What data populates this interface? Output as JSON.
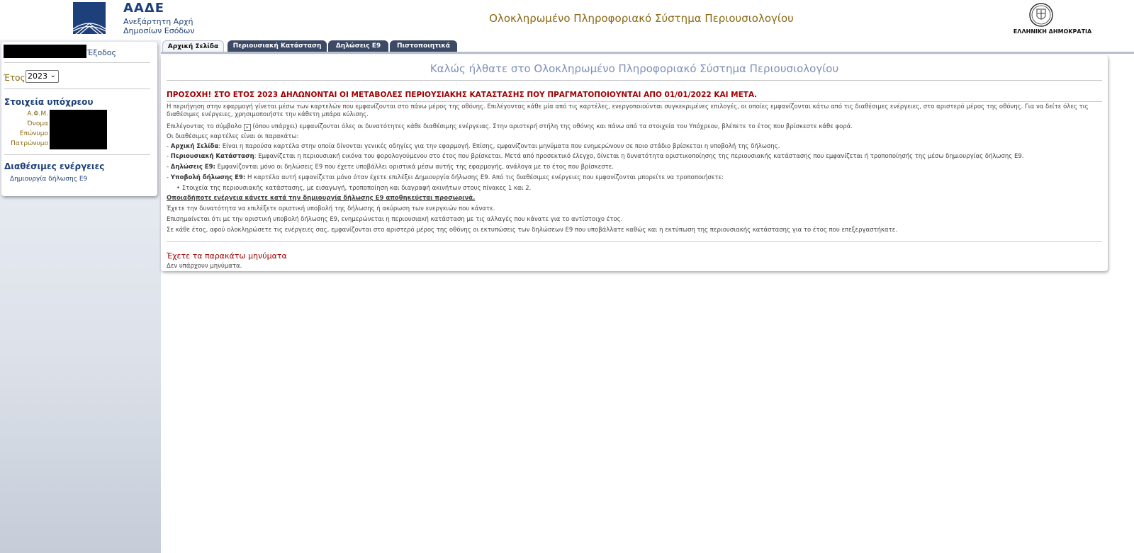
{
  "header": {
    "org_short": "ΑΑΔΕ",
    "org_line1": "Ανεξάρτητη Αρχή",
    "org_line2": "Δημοσίων Εσόδων",
    "app_title": "Ολοκληρωμένο Πληροφοριακό Σύστημα Περιουσιολογίου",
    "republic": "ΕΛΛΗΝΙΚΗ ΔΗΜΟΚΡΑΤΙΑ"
  },
  "sidebar": {
    "exit_label": "Έξοδος",
    "year_label": "Έτος",
    "year_value": "2023",
    "taxpayer_title": "Στοιχεία υπόχρεου",
    "fields": [
      "Α.Φ.Μ.",
      "Όνομα",
      "Επώνυμο",
      "Πατρώνυμο"
    ],
    "actions_title": "Διαθέσιμες ενέργειες",
    "action_create": "Δημιουργία δήλωσης Ε9"
  },
  "tabs": [
    "Αρχική Σελίδα",
    "Περιουσιακή Κατάσταση",
    "Δηλώσεις Ε9",
    "Πιστοποιητικά"
  ],
  "main": {
    "welcome": "Καλώς ήλθατε στο Ολοκληρωμένο Πληροφοριακό Σύστημα Περιουσιολογίου",
    "warning": "ΠΡΟΣΟΧΗ! ΣΤΟ ΕΤΟΣ 2023 ΔΗΛΩΝΟΝΤΑΙ ΟΙ ΜΕΤΑΒΟΛΕΣ ΠΕΡΙΟΥΣΙΑΚΗΣ ΚΑΤΑΣΤΑΣΗΣ ΠΟΥ ΠΡΑΓΜΑΤΟΠΟΙΟΥΝΤΑΙ ΑΠΟ 01/01/2022 ΚΑΙ ΜΕΤΑ.",
    "intro": "Η περιήγηση στην εφαρμογή γίνεται μέσω των καρτελών που εμφανίζονται στο πάνω μέρος της οθόνης. Επιλέγοντας κάθε μία από τις καρτέλες, ενεργοποιούνται συγκεκριμένες επιλογές, οι οποίες εμφανίζονται κάτω από τις διαθέσιμες ενέργειες, στο αριστερό μέρος της οθόνης. Για να δείτε όλες τις διαθέσιμες ενέργειες, χρησιμοποιήστε την κάθετη μπάρα κύλισης.",
    "symbol_a": "Επιλέγοντας το σύμβολο",
    "symbol_b": "(όπου υπάρχει) εμφανίζονται όλες οι δυνατότητες κάθε διαθέσιμης ενέργειας. Στην αριστερή στήλη της οθόνης και πάνω από τα στοιχεία του Υπόχρεου, βλέπετε το έτος που βρίσκεστε κάθε φορά.",
    "tabs_intro": "Οι διαθέσιμες καρτέλες είναι οι παρακάτω:",
    "tab_home_name": "Αρχική Σελίδα",
    "tab_home_desc": ": Είναι η παρούσα καρτέλα στην οποία δίνονται γενικές οδηγίες για την εφαρμογή. Επίσης, εμφανίζονται μηνύματα που ενημερώνουν σε ποιο στάδιο βρίσκεται η υποβολή της δήλωσης.",
    "tab_assets_name": "Περιουσιακή Κατάσταση",
    "tab_assets_desc": ": Εμφανίζεται η περιουσιακή εικόνα του φορολογούμενου στο έτος που βρίσκεται. Μετά από προσεκτικό έλεγχο, δίνεται η δυνατότητα οριστικοποίησης της περιουσιακής κατάστασης που εμφανίζεται ή τροποποίησής της μέσω δημιουργίας δήλωσης Ε9.",
    "tab_decl_name": "Δηλώσεις Ε9:",
    "tab_decl_desc": " Εμφανίζονται μόνο οι δηλώσεις Ε9 που έχετε υποβάλλει οριστικά μέσω αυτής της εφαρμογής, ανάλογα με το έτος που βρίσκεστε.",
    "tab_submit_name": "Υποβολή δήλωσης Ε9:",
    "tab_submit_desc": " Η καρτέλα αυτή εμφανίζεται μόνο όταν έχετε επιλέξει Δημιουργία δήλωσης Ε9. Από τις διαθέσιμες ενέργειες που εμφανίζονται μπορείτε να τροποποιήσετε:",
    "bullet": "Στοιχεία της περιουσιακής κατάστασης, με εισαγωγή, τροποποίηση και διαγραφή ακινήτων στους πίνακες 1 και 2.",
    "temp_note": "Οποιαδήποτε ενέργεια κάνετε κατά την δημιουργία δήλωσης Ε9 αποθηκεύεται προσωρινά.",
    "line_final": "Έχετε την δυνατότητα να επιλέξετε οριστική υποβολή της δήλωσης ή ακύρωση των ενεργειών που κάνατε.",
    "line_update": "Επισημαίνεται ότι με την οριστική υποβολή δήλωσης Ε9, ενημερώνεται η περιουσιακή κατάσταση με τις αλλαγές που κάνατε για το αντίστοιχο έτος.",
    "line_year": "Σε κάθε έτος, αφού ολοκληρώσετε τις ενέργειες σας, εμφανίζονται στο αριστερό μέρος της οθόνης οι εκτυπώσεις των δηλώσεων Ε9 που υποβάλλατε καθώς και η εκτύπωση της περιουσιακής κατάστασης για το έτος που επεξεργαστήκατε.",
    "messages_title": "Έχετε τα παρακάτω μηνύματα",
    "no_messages": "Δεν υπάρχουν μηνύματα."
  },
  "colors": {
    "brand": "#1d3f7a",
    "warning": "#a00000",
    "label": "#8b6914",
    "tab": "#3d4a66"
  }
}
